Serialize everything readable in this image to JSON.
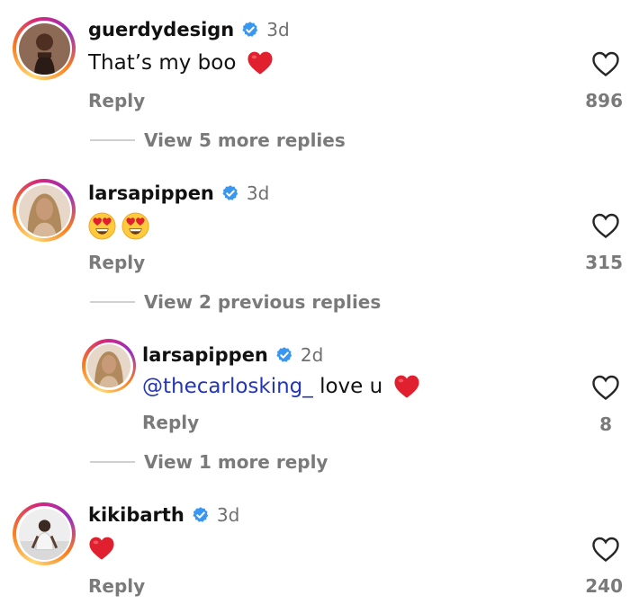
{
  "comments": [
    {
      "username": "guerdydesign",
      "time": "3d",
      "text": "That’s my boo",
      "emoji": "heart",
      "likes": "896",
      "reply_label": "Reply",
      "view_more": "View 5 more replies"
    },
    {
      "username": "larsapippen",
      "time": "3d",
      "text": "",
      "emoji": "heart-eyes-2",
      "likes": "315",
      "reply_label": "Reply",
      "view_more": "View 2 previous replies"
    },
    {
      "username": "larsapippen",
      "time": "2d",
      "mention": "@thecarlosking_",
      "text": " love u",
      "emoji": "heart",
      "likes": "8",
      "reply_label": "Reply",
      "view_more": "View 1 more reply"
    },
    {
      "username": "kikibarth",
      "time": "3d",
      "text": "",
      "emoji": "heart",
      "likes": "240",
      "reply_label": "Reply"
    }
  ],
  "colors": {
    "verified": "#3897f0",
    "mention": "#2436b8",
    "heart": "#e0202e"
  },
  "icons": [
    "verified-badge-icon",
    "heart-outline-icon",
    "red-heart-emoji",
    "heart-eyes-emoji"
  ]
}
